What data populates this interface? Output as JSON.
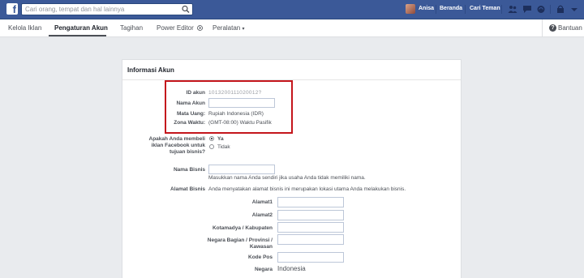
{
  "topbar": {
    "search_placeholder": "Cari orang, tempat dan hal lainnya",
    "user_name": "Anisa",
    "beranda": "Beranda",
    "cari_teman": "Cari Teman",
    "icons": [
      "friend-requests-icon",
      "messages-icon",
      "notifications-icon",
      "lock-icon",
      "settings-icon"
    ]
  },
  "subnav": {
    "tabs": [
      "Kelola Iklan",
      "Pengaturan Akun",
      "Tagihan",
      "Power Editor",
      "Peralatan"
    ],
    "help": "Bantuan",
    "accent": "#4b4f56"
  },
  "panel": {
    "title": "Informasi Akun",
    "id_label": "ID akun",
    "id_value": "1013200111020012?",
    "name_label": "Nama Akun",
    "name_value": "",
    "currency_label": "Mata Uang:",
    "currency_value": "Rupiah Indonesia (IDR)",
    "timezone_label": "Zona Waktu:",
    "timezone_value": "(GMT-08:00) Waktu Pasifik",
    "highlight_color": "#c4161c",
    "business_question": [
      "Apakah Anda membeli",
      "iklan Facebook untuk",
      "tujuan bisnis?"
    ],
    "radio_yes": "Ya",
    "radio_no": "Tidak",
    "biz_name_label": "Nama Bisnis",
    "biz_name_hint": "Masukkan nama Anda sendiri jika usaha Anda tidak memiliki nama.",
    "biz_address_label": "Alamat Bisnis",
    "biz_address_hint": "Anda menyatakan alamat bisnis ini merupakan lokasi utama Anda melakukan bisnis.",
    "address1_label": "Alamat1",
    "address2_label": "Alamat2",
    "city_label": "Kotamadya / Kabupaten",
    "state_label": [
      "Negara Bagian / Provinsi /",
      "Kawasan"
    ],
    "zip_label": "Kode Pos",
    "country_label": "Negara",
    "country_value": "Indonesia"
  }
}
